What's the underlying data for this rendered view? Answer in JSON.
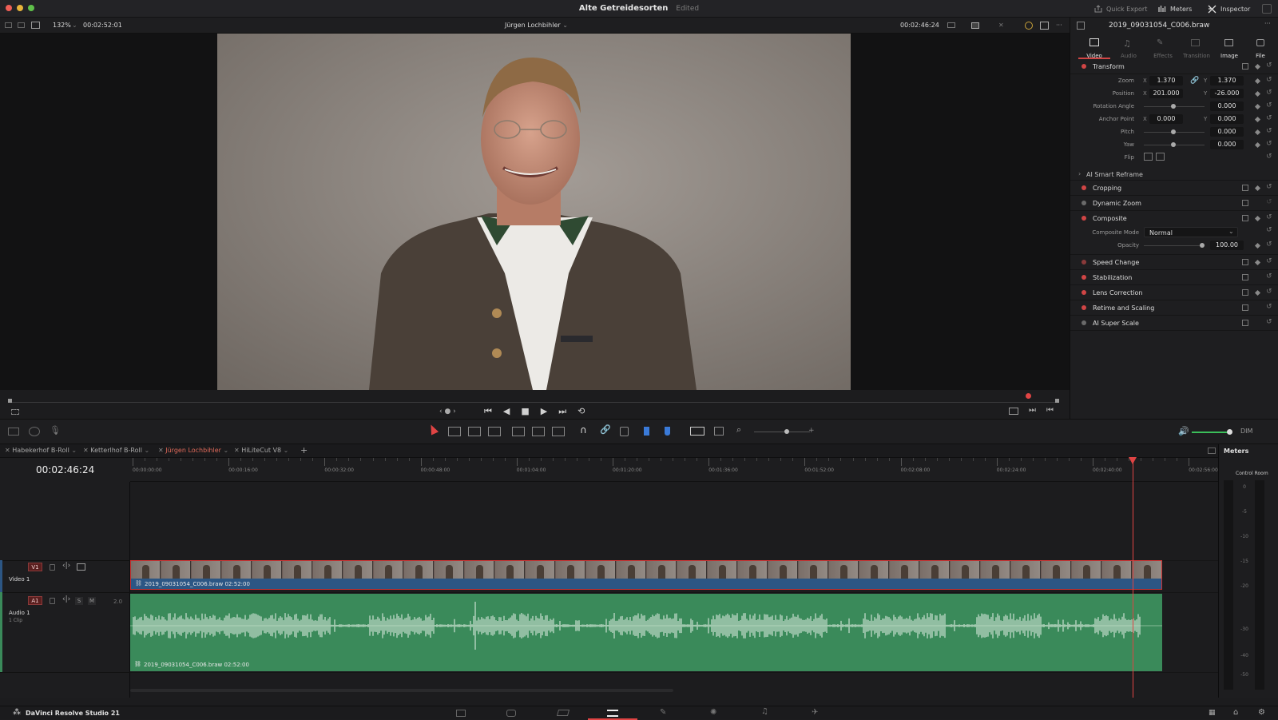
{
  "titlebar": {
    "project": "Alte Getreidesorten",
    "status": "Edited",
    "quick_export": "Quick Export",
    "meters": "Meters",
    "inspector": "Inspector"
  },
  "viewer": {
    "zoom": "132%",
    "source_tc": "00:02:52:01",
    "clip_name": "Jürgen Lochbihler",
    "record_tc": "00:02:46:24"
  },
  "inspector": {
    "clip": "2019_09031054_C006.braw",
    "tabs": [
      "Video",
      "Audio",
      "Effects",
      "Transition",
      "Image",
      "File"
    ],
    "transform": {
      "title": "Transform",
      "zoom": {
        "label": "Zoom",
        "x": "1.370",
        "y": "1.370"
      },
      "position": {
        "label": "Position",
        "x": "201.000",
        "y": "-26.000"
      },
      "rotation": {
        "label": "Rotation Angle",
        "value": "0.000"
      },
      "anchor": {
        "label": "Anchor Point",
        "x": "0.000",
        "y": "0.000"
      },
      "pitch": {
        "label": "Pitch",
        "value": "0.000"
      },
      "yaw": {
        "label": "Yaw",
        "value": "0.000"
      },
      "flip": {
        "label": "Flip"
      },
      "x_axis": "X",
      "y_axis": "Y"
    },
    "smart_reframe": "AI Smart Reframe",
    "sections": [
      "Cropping",
      "Dynamic Zoom",
      "Composite"
    ],
    "composite": {
      "mode_label": "Composite Mode",
      "mode_value": "Normal",
      "opacity_label": "Opacity",
      "opacity_value": "100.00"
    },
    "sections2": [
      "Speed Change",
      "Stabilization",
      "Lens Correction",
      "Retime and Scaling",
      "AI Super Scale"
    ]
  },
  "edit_toolbar": {
    "dim": "DIM"
  },
  "timeline": {
    "tabs": [
      "Habekerhof B-Roll",
      "Ketterlhof B-Roll",
      "Jürgen Lochbihler",
      "HiLiteCut V8"
    ],
    "timecode": "00:02:46:24",
    "ruler": [
      "00:00:00:00",
      "00:00:16:00",
      "00:00:32:00",
      "00:00:48:00",
      "00:01:04:00",
      "00:01:20:00",
      "00:01:36:00",
      "00:01:52:00",
      "00:02:08:00",
      "00:02:24:00",
      "00:02:40:00",
      "00:02:56:00"
    ],
    "v1": {
      "badge": "V1",
      "name": "Video 1"
    },
    "a1": {
      "badge": "A1",
      "name": "Audio 1",
      "clips": "1 Clip",
      "channels": "2.0",
      "solo": "S",
      "mute": "M"
    },
    "video_clip": "2019_09031054_C006.braw  02:52:00",
    "audio_clip": "2019_09031054_C006.braw  02:52:00"
  },
  "meters": {
    "title": "Meters",
    "sub": "Control Room",
    "scale": [
      "0",
      "-5",
      "-10",
      "-15",
      "-20",
      "-30",
      "-40",
      "-50"
    ]
  },
  "pagebar": {
    "app": "DaVinci Resolve Studio 21"
  },
  "colors": {
    "accent_red": "#d04545",
    "video_clip": "#2c5684",
    "audio_clip": "#3a8a5a",
    "playhead": "#e04444"
  }
}
